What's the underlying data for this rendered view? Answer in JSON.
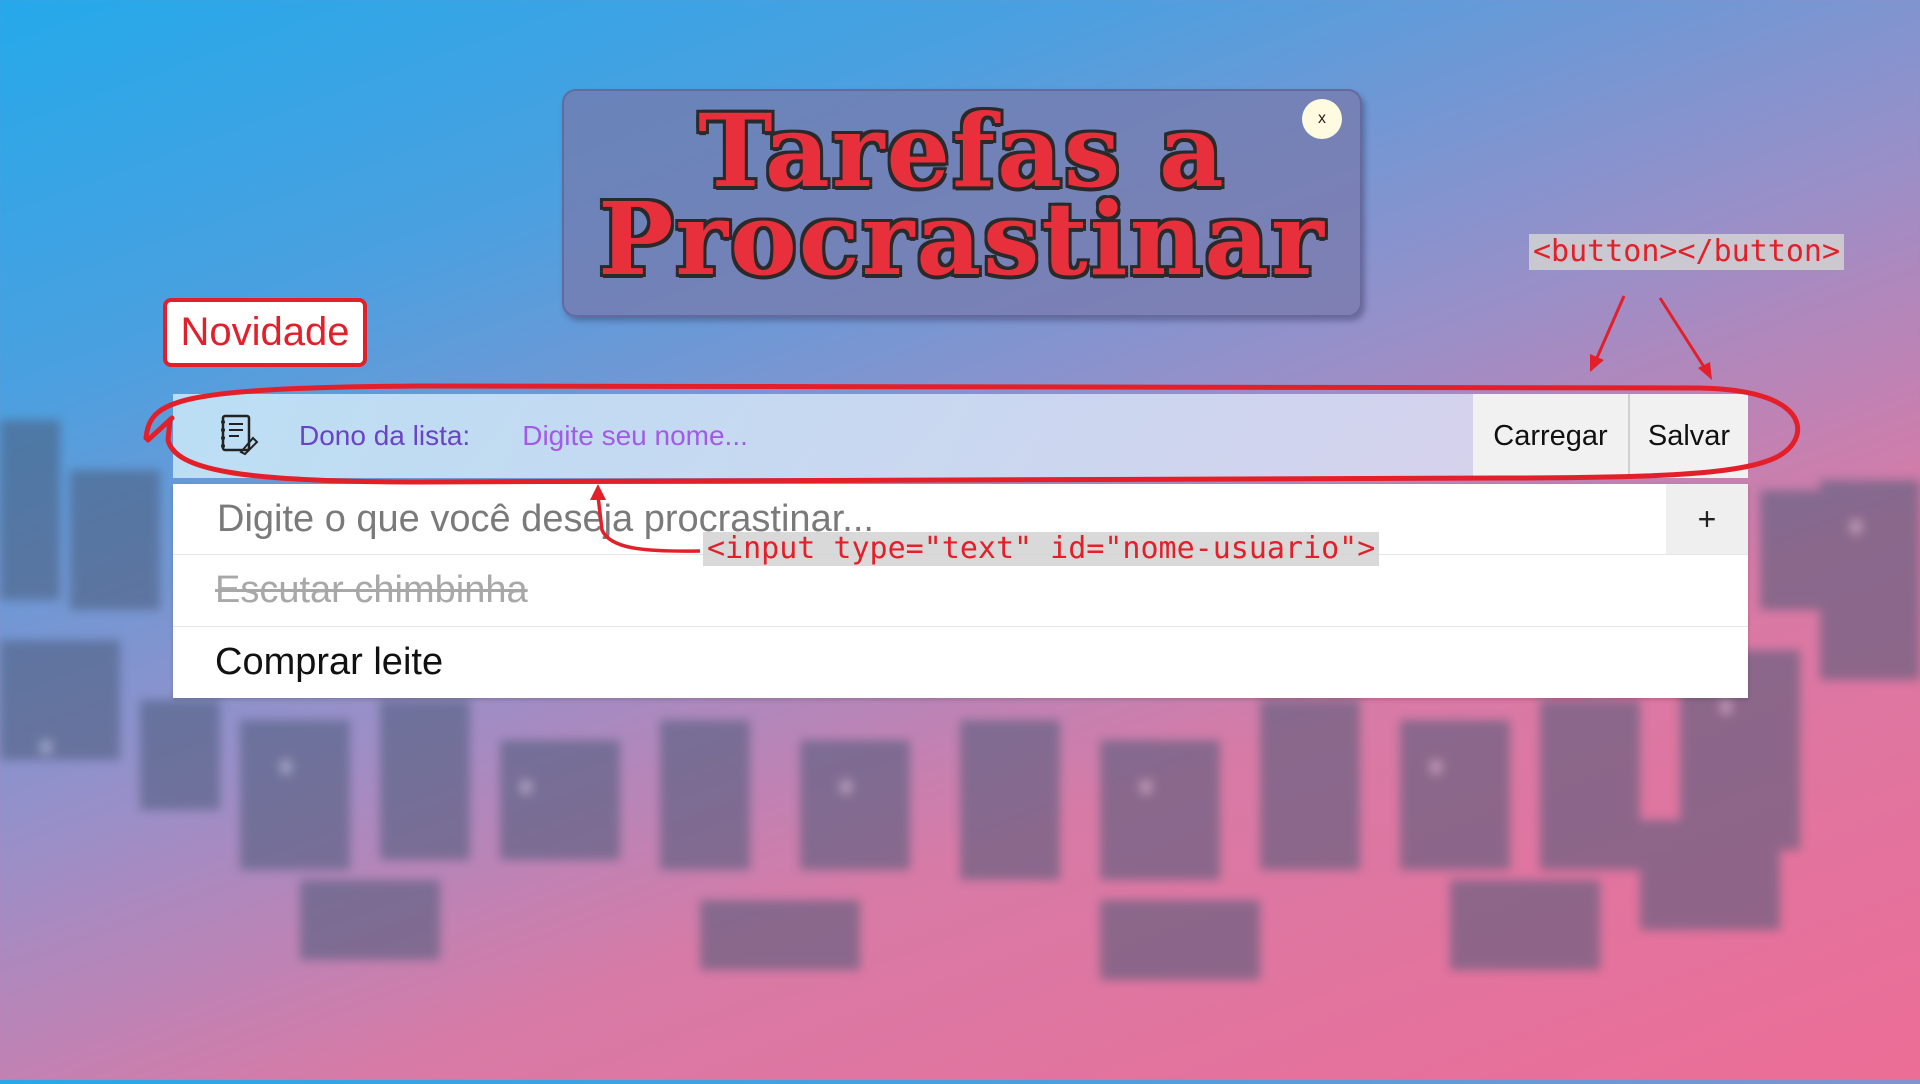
{
  "header": {
    "title_line1": "Tarefas a",
    "title_line2": "Procrastinar",
    "close_label": "x"
  },
  "badge": {
    "label": "Novidade"
  },
  "owner_bar": {
    "icon": "notebook-icon",
    "label": "Dono da lista:",
    "input_placeholder": "Digite seu nome...",
    "load_button": "Carregar",
    "save_button": "Salvar"
  },
  "todo": {
    "input_placeholder": "Digite o que você deseja procrastinar...",
    "add_button": "+",
    "items": [
      {
        "text": "Escutar chimbinha",
        "done": true
      },
      {
        "text": "Comprar leite",
        "done": false
      }
    ]
  },
  "annotations": {
    "button_code": "<button></button>",
    "input_code": "<input type=\"text\" id=\"nome-usuario\">"
  },
  "colors": {
    "annotation_red": "#e3202a",
    "title_red": "#e8303c",
    "owner_label": "#6a43c9",
    "owner_placeholder": "#a35ae8"
  }
}
